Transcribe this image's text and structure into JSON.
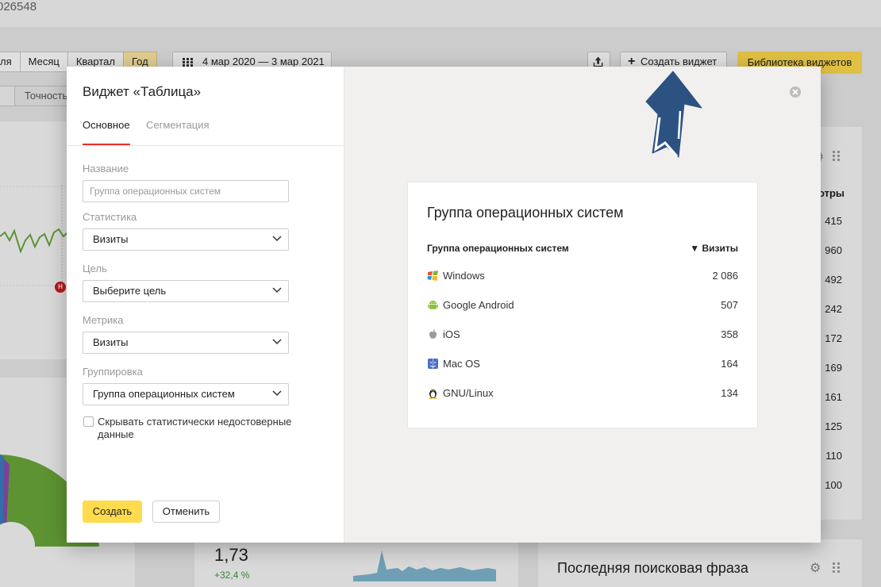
{
  "background": {
    "counter_id": "026548",
    "period_tabs": [
      {
        "label": "ля",
        "active": false
      },
      {
        "label": "Месяц",
        "active": false
      },
      {
        "label": "Квартал",
        "active": false
      },
      {
        "label": "Год",
        "active": true
      }
    ],
    "date_range": "4 мар 2020 — 3 мар 2021",
    "precision_label": "Точность",
    "create_widget_label": "Создать виджет",
    "widget_library_label": "Библиотека виджетов",
    "right_column_header": "отры",
    "right_column_values": [
      "415",
      "960",
      "492",
      "242",
      "172",
      "169",
      "161",
      "125",
      "110",
      "100"
    ],
    "chart_marker": "Н",
    "bottom_value": "1,73",
    "bottom_delta": "+32,4 %",
    "last_search_phrase_title": "Последняя поисковая фраза",
    "colors": {
      "accent_yellow": "#ffdb4d",
      "active_tab_underline": "#e5322d",
      "chart_green": "#6aa83a",
      "positive_delta": "#3a9a3a",
      "annotation_arrow": "#2c5282"
    }
  },
  "modal": {
    "title": "Виджет «Таблица»",
    "tabs": [
      {
        "label": "Основное",
        "active": true
      },
      {
        "label": "Сегментация",
        "active": false
      }
    ],
    "fields": {
      "name_label": "Название",
      "name_placeholder": "Группа операционных систем",
      "statistics_label": "Статистика",
      "statistics_value": "Визиты",
      "goal_label": "Цель",
      "goal_value": "Выберите цель",
      "metric_label": "Метрика",
      "metric_value": "Визиты",
      "grouping_label": "Группировка",
      "grouping_value": "Группа операционных систем"
    },
    "hide_unreliable_label": "Скрывать статистически недостоверные данные",
    "hide_unreliable_checked": false,
    "create_label": "Создать",
    "cancel_label": "Отменить",
    "close_icon": "close-icon"
  },
  "preview": {
    "title": "Группа операционных систем",
    "column_dimension": "Группа операционных систем",
    "column_metric": "▼ Визиты",
    "rows": [
      {
        "icon": "windows-icon",
        "name": "Windows",
        "value": "2 086"
      },
      {
        "icon": "android-icon",
        "name": "Google Android",
        "value": "507"
      },
      {
        "icon": "apple-icon",
        "name": "iOS",
        "value": "358"
      },
      {
        "icon": "macos-icon",
        "name": "Mac OS",
        "value": "164"
      },
      {
        "icon": "linux-icon",
        "name": "GNU/Linux",
        "value": "134"
      }
    ]
  }
}
